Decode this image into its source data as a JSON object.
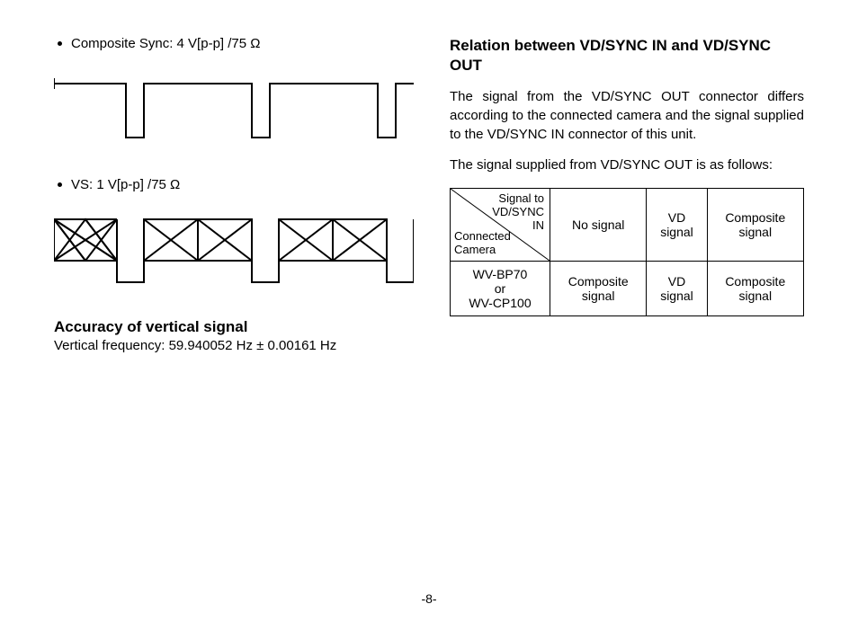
{
  "left": {
    "bullet1": "Composite Sync: 4 V[p-p] /75 Ω",
    "bullet2": "VS: 1 V[p-p] /75 Ω",
    "accuracy_heading": "Accuracy of vertical signal",
    "accuracy_sub": "Vertical frequency: 59.940052 Hz ± 0.00161 Hz"
  },
  "right": {
    "heading": "Relation between VD/SYNC IN and VD/SYNC OUT",
    "para1": "The signal from the VD/SYNC OUT connector differs according to the connected camera and the signal supplied to the VD/SYNC IN connector of this unit.",
    "para2": "The signal supplied from VD/SYNC OUT is as follows:",
    "table": {
      "diag_top": "Signal to\nVD/SYNC\nIN",
      "diag_bottom": "Connected\nCamera",
      "col_headers": [
        "No signal",
        "VD signal",
        "Composite signal"
      ],
      "row1_label": "WV-BP70\nor\nWV-CP100",
      "row1_cells": [
        "Composite signal",
        "VD signal",
        "Composite signal"
      ]
    }
  },
  "footer": "-8-"
}
